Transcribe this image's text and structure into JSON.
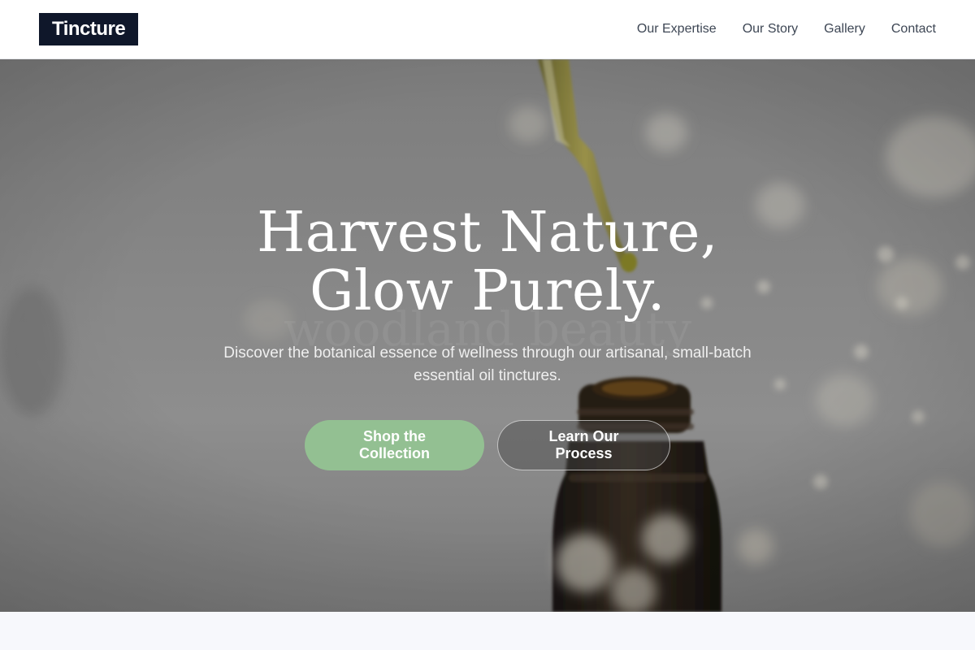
{
  "brand": {
    "logo_text": "Tincture"
  },
  "nav": {
    "links": [
      {
        "label": "Our Expertise"
      },
      {
        "label": "Our Story"
      },
      {
        "label": "Gallery"
      },
      {
        "label": "Contact"
      }
    ]
  },
  "hero": {
    "title": "Harvest Nature, Glow Purely.",
    "subtitle": "Discover the botanical essence of wellness through our artisanal, small-batch essential oil tinctures.",
    "primary_button": "Shop the Collection",
    "secondary_button": "Learn Our Process",
    "background_image": "dropper-over-amber-bottle-with-flowers"
  },
  "colors": {
    "logo_bg": "#0f172a",
    "primary_button": "#93c092",
    "nav_text": "#3d4654",
    "page_bg": "#f7f8fc"
  }
}
